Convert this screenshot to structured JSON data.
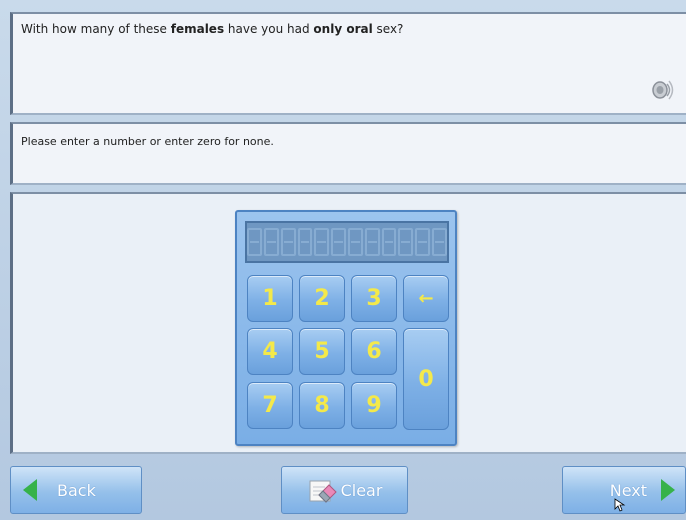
{
  "question": {
    "parts": [
      {
        "text": "With how many of these ",
        "bold": false
      },
      {
        "text": "females",
        "bold": true
      },
      {
        "text": " have you had ",
        "bold": false
      },
      {
        "text": "only oral",
        "bold": true
      },
      {
        "text": " sex?",
        "bold": false
      }
    ],
    "audio_icon": "speaker-icon"
  },
  "instruction": "Please enter a number or enter zero for none.",
  "keypad": {
    "display_value": "",
    "keys": {
      "k1": "1",
      "k2": "2",
      "k3": "3",
      "k4": "4",
      "k5": "5",
      "k6": "6",
      "k7": "7",
      "k8": "8",
      "k9": "9",
      "k0": "0",
      "backspace": "←"
    }
  },
  "nav": {
    "back_label": "Back",
    "clear_label": "Clear",
    "next_label": "Next"
  },
  "colors": {
    "arrow_green": "#36b24a",
    "key_text": "#f4e94a",
    "keypad_blue": "#7aaee6"
  }
}
